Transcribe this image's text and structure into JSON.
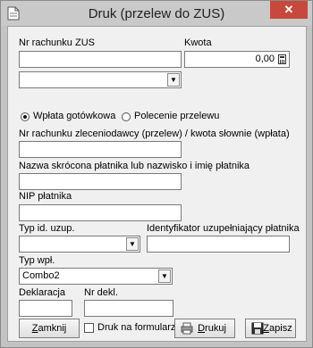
{
  "window": {
    "title": "Druk (przelew do ZUS)",
    "close_glyph": "✕"
  },
  "form": {
    "account_label": "Nr rachunku ZUS",
    "account_value": "",
    "amount_label": "Kwota",
    "amount_value": "0,00",
    "account_select_value": "",
    "radio_cash_label": "Wpłata gotówkowa",
    "radio_transfer_label": "Polecenie przelewu",
    "radio_selected": "cash",
    "principal_account_label": "Nr rachunku zleceniodawcy (przelew) / kwota słownie (wpłata)",
    "principal_account_value": "",
    "payer_name_label": "Nazwa skrócona płatnika lub nazwisko i imię płatnika",
    "payer_name_value": "",
    "nip_label": "NIP płatnika",
    "nip_value": "",
    "id_type_label": "Typ id. uzup.",
    "id_type_value": "",
    "supplementary_id_label": "Identyfikator uzupełniający płatnika",
    "supplementary_id_value": "",
    "payment_type_label": "Typ wpł.",
    "payment_type_value": "Combo2",
    "declaration_label": "Deklaracja",
    "declaration_value": "",
    "decl_no_label": "Nr dekl.",
    "decl_no_value": ""
  },
  "footer": {
    "close_button": {
      "first": "Z",
      "rest": "amknij"
    },
    "print_on_form_label": "Druk na formularzu",
    "print_on_form_checked": false,
    "print_button": {
      "first": "D",
      "rest": "rukuj"
    },
    "save_button": {
      "first": "Z",
      "rest": "apisz"
    }
  },
  "icons": {
    "app": "document-icon",
    "calculator": "calculator-icon",
    "printer": "printer-icon",
    "save": "floppy-disk-icon",
    "dropdown": "chevron-down-icon"
  }
}
